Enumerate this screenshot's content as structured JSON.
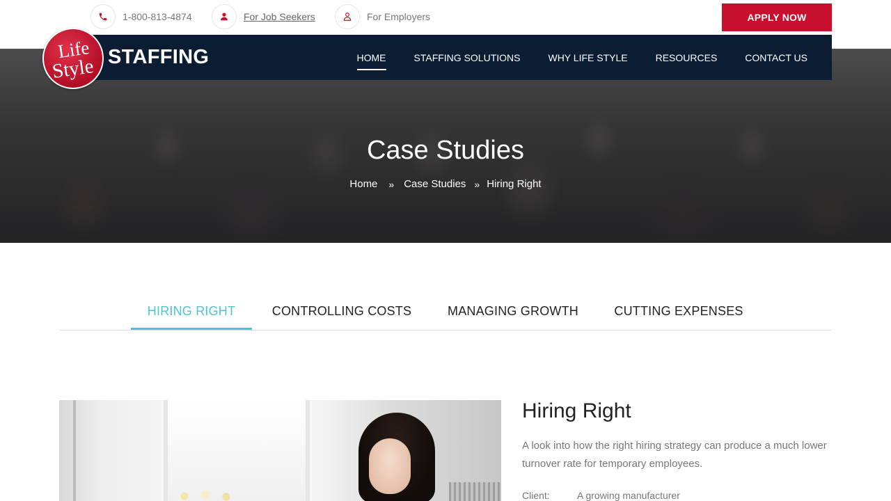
{
  "topbar": {
    "phone": "1-800-813-4874",
    "job_seekers": "For Job Seekers",
    "employers": "For Employers",
    "apply_label": "APPLY NOW"
  },
  "brand": {
    "logo_line1": "Life",
    "logo_line2": "Style",
    "name": "STAFFING"
  },
  "nav": {
    "items": [
      "HOME",
      "STAFFING SOLUTIONS",
      "WHY LIFE STYLE",
      "RESOURCES",
      "CONTACT US"
    ],
    "active": "HOME"
  },
  "hero": {
    "title": "Case Studies",
    "breadcrumb": [
      "Home",
      "Case Studies",
      "Hiring Right"
    ]
  },
  "tabs": {
    "items": [
      "HIRING RIGHT",
      "CONTROLLING COSTS",
      "MANAGING GROWTH",
      "CUTTING EXPENSES"
    ],
    "active": "HIRING RIGHT"
  },
  "study": {
    "title": "Hiring Right",
    "description": "A look into how the right hiring strategy can produce a much lower turnover rate for temporary employees.",
    "client_label": "Client:",
    "client_value": "A growing manufacturer"
  },
  "colors": {
    "accent_red": "#c8102e",
    "nav_navy": "#0c1d33",
    "tab_active": "#4ec3d6"
  },
  "icons": [
    "phone-icon",
    "user-icon",
    "user-outline-icon",
    "chevron-right-icon"
  ]
}
